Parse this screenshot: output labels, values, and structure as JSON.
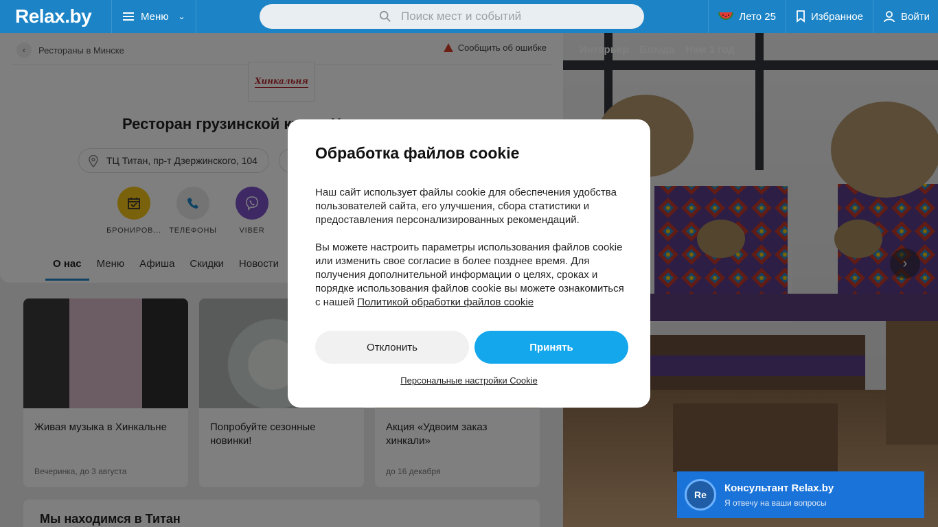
{
  "header": {
    "logo": "Relax.by",
    "menu_label": "Меню",
    "search_placeholder": "Поиск мест и событий",
    "summer_label": "Лето 25",
    "favorites_label": "Избранное",
    "login_label": "Войти"
  },
  "breadcrumb": {
    "back_label": "Рестораны в Минске"
  },
  "report_label": "Сообщить об ошибке",
  "restaurant": {
    "logo_text": "Хинкальня",
    "title": "Ресторан грузинской кухни Х",
    "address": "ТЦ Титан, пр-т Дзержинского, 104"
  },
  "actions": [
    {
      "label": "БРОНИРОВ...",
      "color": "#f5c518"
    },
    {
      "label": "ТЕЛЕФОНЫ",
      "color": "#e9e9e9"
    },
    {
      "label": "VIBER",
      "color": "#7c52c8"
    }
  ],
  "tabs": [
    "О нас",
    "Меню",
    "Афиша",
    "Скидки",
    "Новости"
  ],
  "promos": [
    {
      "title": "Живая музыка в Хинкальне",
      "sub": "Вечеринка, до 3 августа"
    },
    {
      "title": "Попробуйте сезонные новинки!",
      "sub": ""
    },
    {
      "title": "Акция «Удвоим заказ хинкали»",
      "sub": "до 16 декабря"
    }
  ],
  "location_heading": "Мы находимся в Титан",
  "photo_tabs": [
    "Интерьер",
    "Блюда",
    "Нам 1 год"
  ],
  "cookie_modal": {
    "title": "Обработка файлов cookie",
    "para1": "Наш сайт использует файлы cookie для обеспечения удобства пользователей сайта, его улучшения, сбора статистики и предоставления персонализированных рекомендаций.",
    "para2": "Вы можете настроить параметры использования файлов cookie или изменить свое согласие в более позднее время. Для получения дополнительной информации о целях, сроках и порядке использования файлов cookie вы можете ознакомиться с нашей",
    "policy_link": "Политикой обработки файлов cookie",
    "decline_label": "Отклонить",
    "accept_label": "Принять",
    "settings_link": "Персональные настройки Cookie"
  },
  "consultant": {
    "avatar": "Re",
    "title": "Консультант Relax.by",
    "subtitle": "Я отвечу на ваши вопросы"
  },
  "colors": {
    "brand": "#1c84c6",
    "accent": "#14a7ec",
    "consult": "#1a73d9"
  }
}
